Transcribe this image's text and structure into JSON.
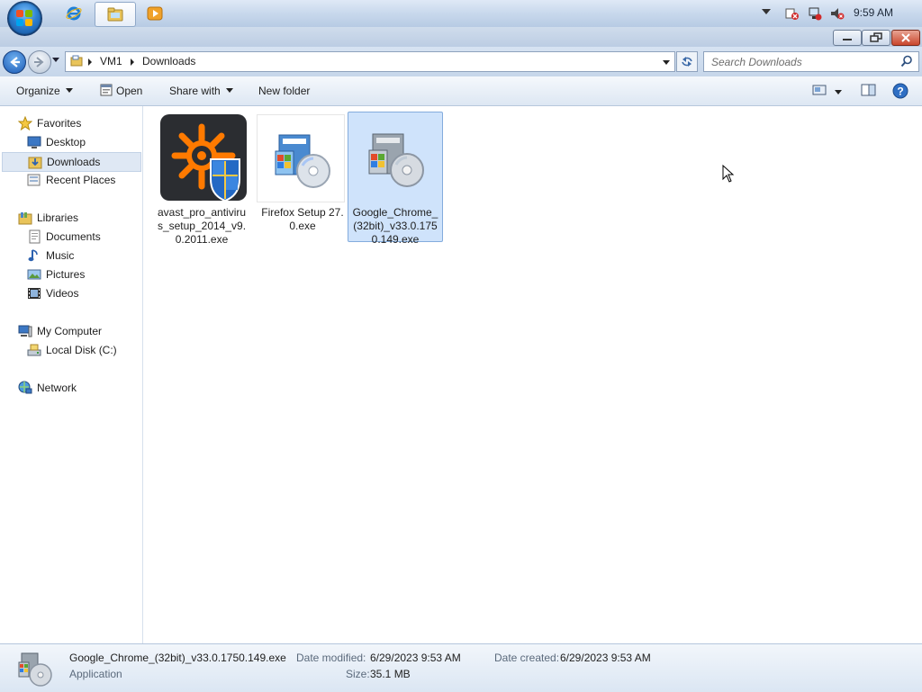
{
  "taskbar": {
    "start_icon": "windows-flag-icon",
    "buttons": [
      {
        "icon": "internet-explorer-icon"
      },
      {
        "icon": "explorer-folder-icon",
        "active": true
      },
      {
        "icon": "media-player-icon"
      }
    ],
    "tray_icons": [
      "show-hidden-icons-triangle",
      "action-center-icon",
      "network-icon",
      "volume-muted-icon"
    ],
    "clock": "9:59 AM"
  },
  "address": {
    "breadcrumbs": [
      "VM1",
      "Downloads"
    ]
  },
  "search": {
    "placeholder": "Search Downloads"
  },
  "toolbar": {
    "organize": "Organize",
    "open": "Open",
    "share_with": "Share with",
    "new_folder": "New folder"
  },
  "nav": {
    "favorites": {
      "label": "Favorites",
      "items": [
        "Desktop",
        "Downloads",
        "Recent Places"
      ],
      "selected": "Downloads"
    },
    "libraries": {
      "label": "Libraries",
      "items": [
        "Documents",
        "Music",
        "Pictures",
        "Videos"
      ]
    },
    "computer": {
      "label": "My Computer",
      "items": [
        "Local Disk (C:)"
      ]
    },
    "network": {
      "label": "Network"
    }
  },
  "files": [
    {
      "name": "avast_pro_antivirus_setup_2014_v9.0.2011.exe",
      "icon": "avast-setup-icon",
      "selected": false
    },
    {
      "name": "Firefox Setup 27.0.exe",
      "icon": "installer-cd-icon",
      "selected": false
    },
    {
      "name": "Google_Chrome_(32bit)_v33.0.1750.149.exe",
      "icon": "installer-cd-icon",
      "selected": true
    }
  ],
  "details": {
    "filename": "Google_Chrome_(32bit)_v33.0.1750.149.exe",
    "type": "Application",
    "date_modified_label": "Date modified:",
    "date_modified": "6/29/2023 9:53 AM",
    "date_created_label": "Date created:",
    "date_created": "6/29/2023 9:53 AM",
    "size_label": "Size:",
    "size": "35.1 MB"
  },
  "colors": {
    "selection_fill": "#cfe3fb",
    "selection_border": "#84acdd",
    "chrome_blue": "#c8d8ec",
    "close_red": "#c9462c"
  }
}
